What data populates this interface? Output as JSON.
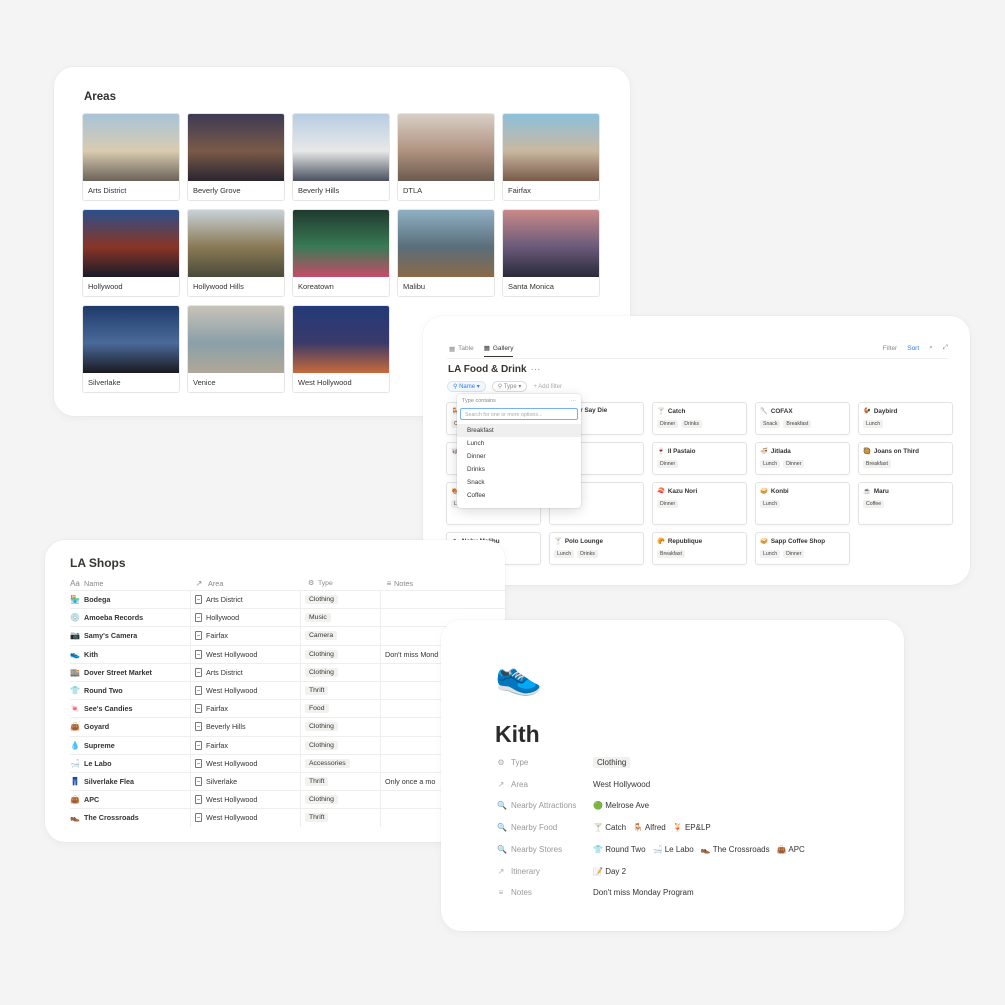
{
  "areas": {
    "title": "Areas",
    "items": [
      {
        "label": "Arts District",
        "colors": [
          "#a8c4d8",
          "#d9cbb0",
          "#6b6358"
        ]
      },
      {
        "label": "Beverly Grove",
        "colors": [
          "#3d3a55",
          "#7a5a48",
          "#2a2530"
        ]
      },
      {
        "label": "Beverly Hills",
        "colors": [
          "#b7cde3",
          "#e8e8e8",
          "#4a5160"
        ]
      },
      {
        "label": "DTLA",
        "colors": [
          "#d8cfc6",
          "#b09380",
          "#6b5a4e"
        ]
      },
      {
        "label": "Fairfax",
        "colors": [
          "#8dc0dc",
          "#c9b8a0",
          "#7a5a4a"
        ]
      },
      {
        "label": "Hollywood",
        "colors": [
          "#2a4f8c",
          "#8a3525",
          "#1a1a2a"
        ]
      },
      {
        "label": "Hollywood Hills",
        "colors": [
          "#c8d2d8",
          "#8a7a55",
          "#4a4a3a"
        ]
      },
      {
        "label": "Koreatown",
        "colors": [
          "#1f3a2f",
          "#3a7a55",
          "#c64b6a"
        ]
      },
      {
        "label": "Malibu",
        "colors": [
          "#8fb0c4",
          "#5a6e7a",
          "#8a6a48"
        ]
      },
      {
        "label": "Santa Monica",
        "colors": [
          "#c98a8a",
          "#6a5a7a",
          "#2a2a3a"
        ]
      },
      {
        "label": "Silverlake",
        "colors": [
          "#1e3a6a",
          "#4a6a9a",
          "#1a1a20"
        ]
      },
      {
        "label": "Venice",
        "colors": [
          "#c8c2b8",
          "#8aa0a8",
          "#b0a898"
        ]
      },
      {
        "label": "West Hollywood",
        "colors": [
          "#233a7a",
          "#3a3a6a",
          "#c86a3a"
        ]
      }
    ]
  },
  "food": {
    "tabs": [
      "Table",
      "Gallery"
    ],
    "tools": [
      "Filter",
      "Sort"
    ],
    "title": "LA Food & Drink",
    "filters": [
      "Name",
      "Type"
    ],
    "add_filter": "Add filter",
    "dropdown": {
      "header": "Type contains",
      "placeholder": "Search for one or more options...",
      "options": [
        "Breakfast",
        "Lunch",
        "Dinner",
        "Drinks",
        "Snack",
        "Coffee"
      ]
    },
    "cards": [
      {
        "icon": "🪑",
        "name": "",
        "tags": [
          "C"
        ]
      },
      {
        "icon": "",
        "name": "ers Never Say Die",
        "tags": []
      },
      {
        "icon": "🍸",
        "name": "Catch",
        "tags": [
          "Dinner",
          "Drinks"
        ]
      },
      {
        "icon": "🥄",
        "name": "COFAX",
        "tags": [
          "Snack",
          "Breakfast"
        ]
      },
      {
        "icon": "🐓",
        "name": "Daybird",
        "tags": [
          "Lunch"
        ]
      },
      {
        "icon": "🥡",
        "name": "",
        "tags": []
      },
      {
        "icon": "",
        "name": "rey's",
        "tags": [
          "Dinner"
        ]
      },
      {
        "icon": "🍷",
        "name": "Il Pastaio",
        "tags": [
          "Dinner"
        ]
      },
      {
        "icon": "🍜",
        "name": "Jitlada",
        "tags": [
          "Lunch",
          "Dinner"
        ]
      },
      {
        "icon": "🥘",
        "name": "Joans on Third",
        "tags": [
          "Breakfast"
        ]
      },
      {
        "icon": "🍖",
        "name": "",
        "tags": [
          "L"
        ]
      },
      {
        "icon": "",
        "name": "Ho Dong",
        "tags": [
          "Dinner"
        ]
      },
      {
        "icon": "🍣",
        "name": "Kazu Nori",
        "tags": [
          "Dinner"
        ]
      },
      {
        "icon": "🥪",
        "name": "Konbi",
        "tags": [
          "Lunch"
        ]
      },
      {
        "icon": "☕",
        "name": "Maru",
        "tags": [
          "Coffee"
        ]
      },
      {
        "icon": "🐟",
        "name": "Nobu Malibu",
        "tags": [
          "Lunch",
          "Dinner"
        ]
      },
      {
        "icon": "🍸",
        "name": "Polo Lounge",
        "tags": [
          "Lunch",
          "Drinks"
        ]
      },
      {
        "icon": "🥐",
        "name": "Republique",
        "tags": [
          "Breakfast"
        ]
      },
      {
        "icon": "🥪",
        "name": "Sapp Coffee Shop",
        "tags": [
          "Lunch",
          "Dinner"
        ]
      }
    ]
  },
  "shops": {
    "title": "LA Shops",
    "columns": [
      "Name",
      "Area",
      "Type",
      "Notes"
    ],
    "rows": [
      {
        "icon": "🏪",
        "name": "Bodega",
        "area": "Arts District",
        "type": "Clothing",
        "notes": ""
      },
      {
        "icon": "💿",
        "name": "Amoeba Records",
        "area": "Hollywood",
        "type": "Music",
        "notes": ""
      },
      {
        "icon": "📷",
        "name": "Samy's Camera",
        "area": "Fairfax",
        "type": "Camera",
        "notes": ""
      },
      {
        "icon": "👟",
        "name": "Kith",
        "area": "West Hollywood",
        "type": "Clothing",
        "notes": "Don't miss Mond"
      },
      {
        "icon": "🏬",
        "name": "Dover Street Market",
        "area": "Arts District",
        "type": "Clothing",
        "notes": ""
      },
      {
        "icon": "👕",
        "name": "Round Two",
        "area": "West Hollywood",
        "type": "Thrift",
        "notes": ""
      },
      {
        "icon": "🍬",
        "name": "See's Candies",
        "area": "Fairfax",
        "type": "Food",
        "notes": ""
      },
      {
        "icon": "👜",
        "name": "Goyard",
        "area": "Beverly Hills",
        "type": "Clothing",
        "notes": ""
      },
      {
        "icon": "💧",
        "name": "Supreme",
        "area": "Fairfax",
        "type": "Clothing",
        "notes": ""
      },
      {
        "icon": "🛁",
        "name": "Le Labo",
        "area": "West Hollywood",
        "type": "Accessories",
        "notes": ""
      },
      {
        "icon": "👖",
        "name": "Silverlake Flea",
        "area": "Silverlake",
        "type": "Thrift",
        "notes": "Only once a mo"
      },
      {
        "icon": "👜",
        "name": "APC",
        "area": "West Hollywood",
        "type": "Clothing",
        "notes": ""
      },
      {
        "icon": "👞",
        "name": "The Crossroads",
        "area": "West Hollywood",
        "type": "Thrift",
        "notes": ""
      }
    ]
  },
  "kith": {
    "icon": "👟",
    "title": "Kith",
    "props": [
      {
        "key": "Type",
        "icon": "⚙",
        "values": [
          {
            "text": "Clothing",
            "pill": true
          }
        ]
      },
      {
        "key": "Area",
        "icon": "↗",
        "values": [
          {
            "text": "West Hollywood"
          }
        ]
      },
      {
        "key": "Nearby Attractions",
        "icon": "🔍",
        "values": [
          {
            "icon": "🟢",
            "text": "Melrose Ave"
          }
        ]
      },
      {
        "key": "Nearby Food",
        "icon": "🔍",
        "values": [
          {
            "icon": "🍸",
            "text": "Catch"
          },
          {
            "icon": "🪑",
            "text": "Alfred"
          },
          {
            "icon": "🍹",
            "text": "EP&LP"
          }
        ]
      },
      {
        "key": "Nearby Stores",
        "icon": "🔍",
        "values": [
          {
            "icon": "👕",
            "text": "Round Two"
          },
          {
            "icon": "🛁",
            "text": "Le Labo"
          },
          {
            "icon": "👞",
            "text": "The Crossroads"
          },
          {
            "icon": "👜",
            "text": "APC"
          }
        ]
      },
      {
        "key": "Itinerary",
        "icon": "↗",
        "values": [
          {
            "icon": "📝",
            "text": "Day 2"
          }
        ]
      },
      {
        "key": "Notes",
        "icon": "≡",
        "values": [
          {
            "text": "Don't miss Monday Program"
          }
        ]
      }
    ]
  }
}
